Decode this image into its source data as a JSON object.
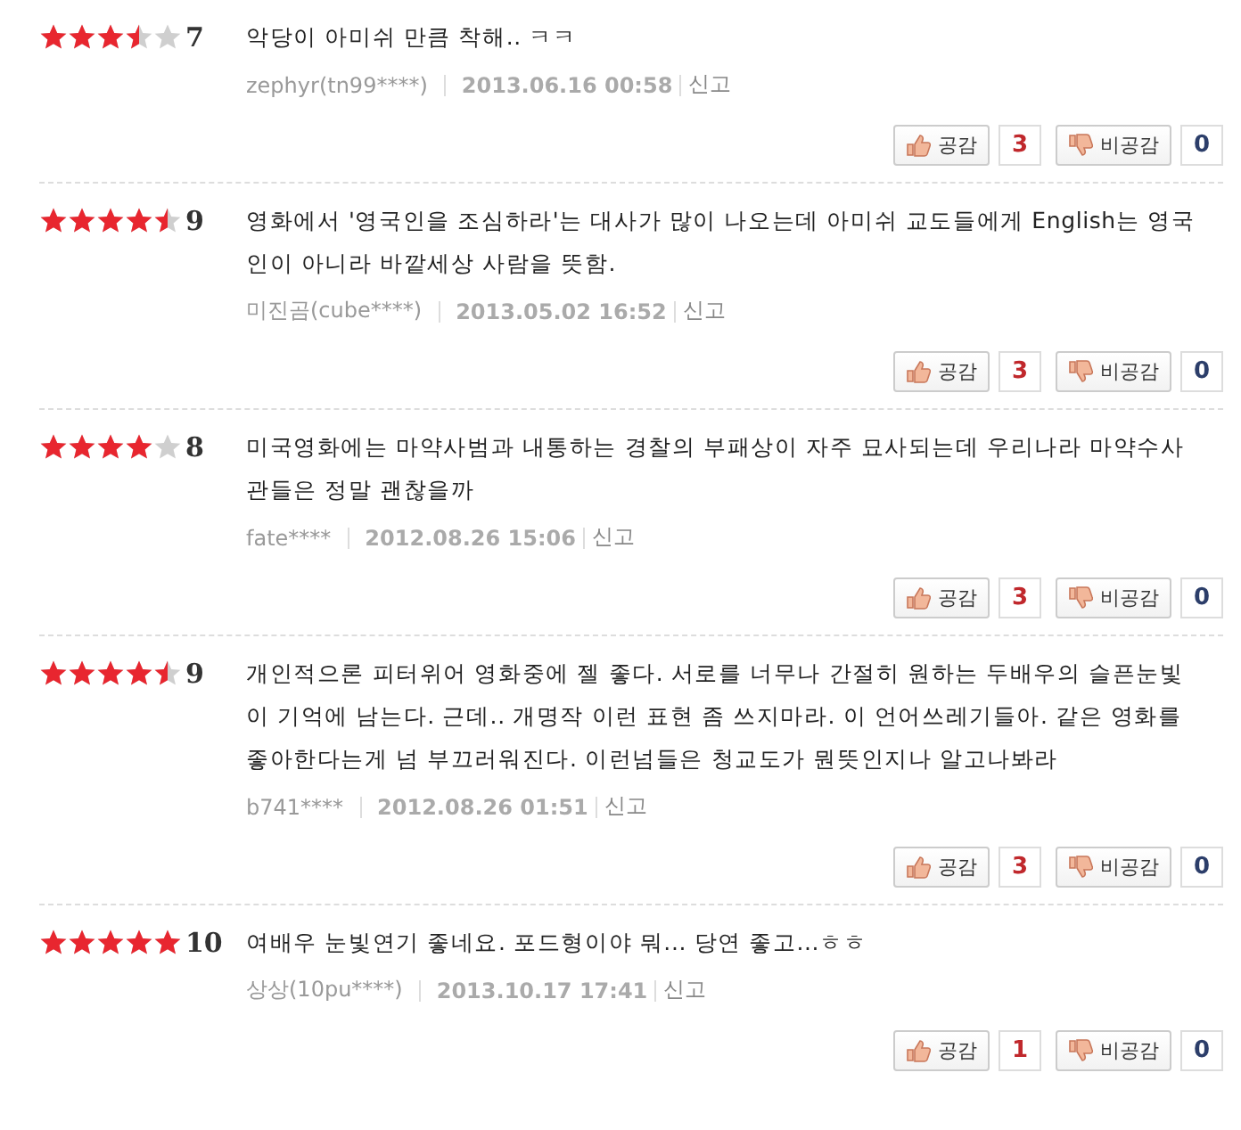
{
  "reviews": [
    {
      "stars": 3.5,
      "score": "7",
      "text": "악당이 아미쉬 만큼 착해.. ㅋㅋ",
      "author": "zephyr(tn99****)",
      "date": "2013.06.16 00:58",
      "report": "신고",
      "like_label": "공감",
      "like_count": "3",
      "dislike_label": "비공감",
      "dislike_count": "0"
    },
    {
      "stars": 4.5,
      "score": "9",
      "text": "영화에서 '영국인을 조심하라'는 대사가 많이 나오는데 아미쉬 교도들에게 English는 영국인이 아니라 바깥세상 사람을 뜻함.",
      "author": "미진곰(cube****)",
      "date": "2013.05.02 16:52",
      "report": "신고",
      "like_label": "공감",
      "like_count": "3",
      "dislike_label": "비공감",
      "dislike_count": "0"
    },
    {
      "stars": 4,
      "score": "8",
      "text": "미국영화에는 마약사범과 내통하는 경찰의 부패상이 자주 묘사되는데 우리나라 마약수사관들은 정말 괜찮을까",
      "author": "fate****",
      "date": "2012.08.26 15:06",
      "report": "신고",
      "like_label": "공감",
      "like_count": "3",
      "dislike_label": "비공감",
      "dislike_count": "0"
    },
    {
      "stars": 4.5,
      "score": "9",
      "text": "개인적으론 피터위어 영화중에 젤 좋다. 서로를 너무나 간절히 원하는 두배우의 슬픈눈빛이 기억에 남는다. 근데.. 개명작 이런 표현 좀 쓰지마라. 이 언어쓰레기들아. 같은 영화를 좋아한다는게 넘 부끄러워진다. 이런넘들은 청교도가 뭔뜻인지나 알고나봐라",
      "author": "b741****",
      "date": "2012.08.26 01:51",
      "report": "신고",
      "like_label": "공감",
      "like_count": "3",
      "dislike_label": "비공감",
      "dislike_count": "0"
    },
    {
      "stars": 5,
      "score": "10",
      "text": "여배우 눈빛연기 좋네요. 포드형이야 뭐... 당연 좋고...ㅎㅎ",
      "author": "상상(10pu****)",
      "date": "2013.10.17 17:41",
      "report": "신고",
      "like_label": "공감",
      "like_count": "1",
      "dislike_label": "비공감",
      "dislike_count": "0"
    }
  ]
}
